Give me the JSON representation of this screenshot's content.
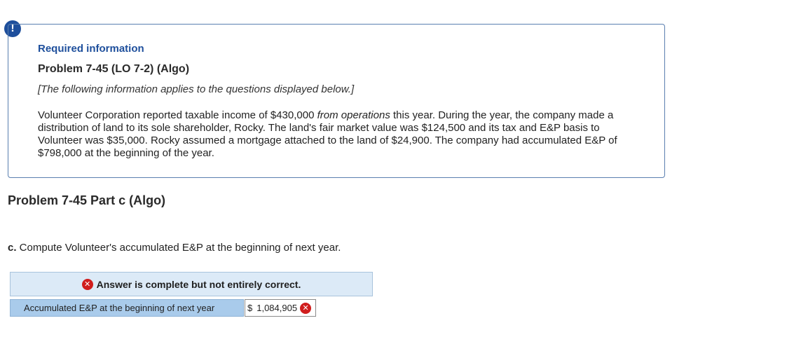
{
  "alert_icon": "!",
  "info_box": {
    "required_label": "Required information",
    "problem_heading": "Problem 7-45 (LO 7-2) (Algo)",
    "note": "[The following information applies to the questions displayed below.]",
    "paragraph_part1": "Volunteer Corporation reported taxable income of $430,000 ",
    "paragraph_italic": "from operations",
    "paragraph_part2": " this year. During the year, the company made a distribution of land to its sole shareholder, Rocky. The land's fair market value was $124,500 and its tax and E&P basis to Volunteer was $35,000. Rocky assumed a mortgage attached to the land of $24,900. The company had accumulated E&P of $798,000 at the beginning of the year."
  },
  "part_heading": "Problem 7-45 Part c (Algo)",
  "question": {
    "letter": "c.",
    "text": " Compute Volunteer's accumulated E&P at the beginning of next year."
  },
  "answer": {
    "banner_text": "Answer is complete but not entirely correct.",
    "row_label": "Accumulated E&P at the beginning of next year",
    "currency": "$",
    "value": "1,084,905",
    "status_icon": "x-mark-icon",
    "status_color": "#d01d1d"
  }
}
